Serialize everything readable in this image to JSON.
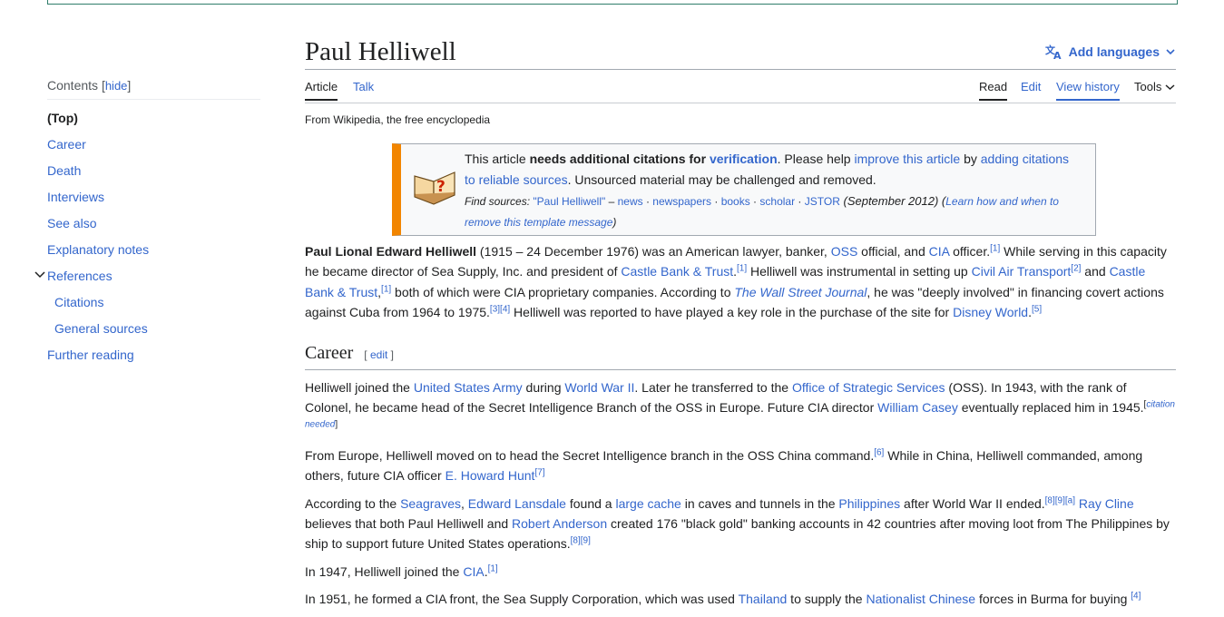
{
  "toc": {
    "title": "Contents",
    "hide_label": "hide",
    "items": [
      {
        "label": "(Top)"
      },
      {
        "label": "Career"
      },
      {
        "label": "Death"
      },
      {
        "label": "Interviews"
      },
      {
        "label": "See also"
      },
      {
        "label": "Explanatory notes"
      },
      {
        "label": "References"
      },
      {
        "label": "Citations"
      },
      {
        "label": "General sources"
      },
      {
        "label": "Further reading"
      }
    ]
  },
  "page": {
    "title": "Paul Helliwell",
    "add_languages": "Add languages",
    "from": "From Wikipedia, the free encyclopedia"
  },
  "tabs": {
    "article": "Article",
    "talk": "Talk",
    "read": "Read",
    "edit": "Edit",
    "view_history": "View history",
    "tools": "Tools"
  },
  "ambox": {
    "t1": "This article ",
    "t2": "needs additional citations for ",
    "t3": "verification",
    "t4": ". Please help ",
    "t5": "improve this article",
    "t6": " by ",
    "t7": "adding citations to reliable sources",
    "t8": ". Unsourced material may be challenged and removed.",
    "find_sources": "Find sources:",
    "q": "\"Paul Helliwell\"",
    "dash": " – ",
    "news": "news",
    "newspapers": "newspapers",
    "books": "books",
    "scholar": "scholar",
    "jstor": "JSTOR",
    "date": " (September 2012) (",
    "learn": "Learn how and when to remove this template message",
    "close": ")"
  },
  "intro": {
    "bold_name": "Paul Lional Edward Helliwell",
    "a1": " (1915 – 24 December 1976) was an American lawyer, banker, ",
    "oss": "OSS",
    "a2": " official, and ",
    "cia": "CIA",
    "a3": " officer.",
    "r1": "[1]",
    "a4": " While serving in this capacity he became director of Sea Supply, Inc. and president of ",
    "castle1": "Castle Bank & Trust",
    "a5": ".",
    "r2": "[1]",
    "a6": " Helliwell was instrumental in setting up ",
    "cat": "Civil Air Transport",
    "r3": "[2]",
    "a7": " and ",
    "castle2": "Castle Bank & Trust",
    "a8": ",",
    "r4": "[1]",
    "a9": " both of which were CIA proprietary companies. According to ",
    "wsj": "The Wall Street Journal",
    "a10": ", he was \"deeply involved\" in financing covert actions against Cuba from 1964 to 1975.",
    "r5": "[3]",
    "r6": "[4]",
    "a11": " Helliwell was reported to have played a key role in the purchase of the site for ",
    "disney": "Disney World",
    "a12": ".",
    "r7": "[5]"
  },
  "career": {
    "heading": "Career",
    "edit_open": "[ ",
    "edit": "edit",
    "edit_close": " ]",
    "p1": {
      "a1": "Helliwell joined the ",
      "usa": "United States Army",
      "a2": " during ",
      "ww2": "World War II",
      "a3": ". Later he transferred to the ",
      "oss": "Office of Strategic Services",
      "a4": " (OSS). In 1943, with the rank of Colonel, he became head of the Secret Intelligence Branch of the OSS in Europe. Future CIA director ",
      "casey": "William Casey",
      "a5": " eventually replaced him in 1945.",
      "cn_open": "[",
      "cn": "citation needed",
      "cn_close": "]"
    },
    "p2": {
      "a1": "From Europe, Helliwell moved on to head the Secret Intelligence branch in the OSS China command.",
      "r1": "[6]",
      "a2": " While in China, Helliwell commanded, among others, future CIA officer ",
      "hunt": "E. Howard Hunt",
      "r2": "[7]"
    },
    "p3": {
      "a1": "According to the ",
      "seagraves": "Seagraves",
      "a2": ", ",
      "lansdale": "Edward Lansdale",
      "a3": " found a ",
      "cache": "large cache",
      "a4": " in caves and tunnels in the ",
      "phil": "Philippines",
      "a5": " after World War II ended.",
      "r1": "[8]",
      "r2": "[9]",
      "r3": "[a]",
      "a6": " ",
      "cline": "Ray Cline",
      "a7": " believes that both Paul Helliwell and ",
      "anderson": "Robert Anderson",
      "a8": " created 176 \"black gold\" banking accounts in 42 countries after moving loot from The Philippines by ship to support future United States operations.",
      "r4": "[8]",
      "r5": "[9]"
    },
    "p4": {
      "a1": "In 1947, Helliwell joined the ",
      "cia": "CIA",
      "a2": ".",
      "r1": "[1]"
    },
    "p5": {
      "a1": "In 1951, he formed a CIA front, the Sea Supply Corporation, which was used ",
      "thai": "Thailand",
      "a2": " to supply the ",
      "nc": "Nationalist Chinese",
      "a3": " forces in Burma for buying ",
      "r1": "[4]"
    }
  }
}
